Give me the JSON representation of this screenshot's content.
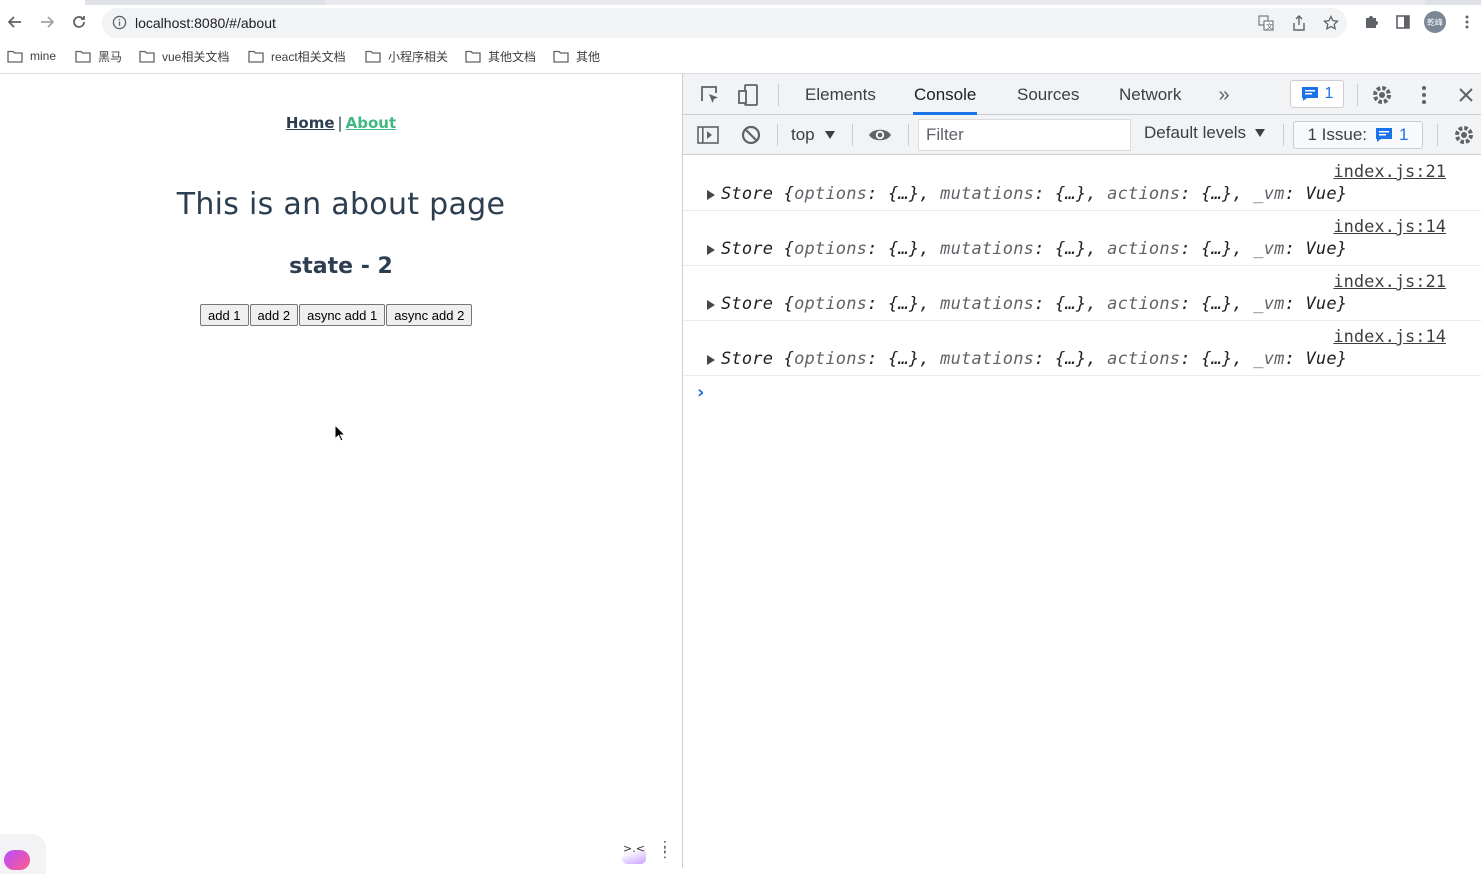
{
  "browser": {
    "url": "localhost:8080/#/about",
    "profile_label": "乾峰",
    "bookmarks": [
      "mine",
      "黑马",
      "vue相关文档",
      "react相关文档",
      "小程序相关",
      "其他文档",
      "其他"
    ]
  },
  "page": {
    "nav": {
      "home": "Home",
      "separator": "|",
      "about": "About"
    },
    "title": "This is an about page",
    "state_text": "state - 2",
    "buttons": [
      "add 1",
      "add 2",
      "async add 1",
      "async add 2"
    ],
    "bottom_right_icon_text": ">.<",
    "colors": {
      "text": "#2c3e50",
      "active_link": "#42b983"
    }
  },
  "devtools": {
    "tabs": [
      "Elements",
      "Console",
      "Sources",
      "Network"
    ],
    "active_tab": "Console",
    "message_count": "1",
    "context": "top",
    "filter_placeholder": "Filter",
    "levels": "Default levels",
    "issues_label": "1 Issue:",
    "issues_count": "1",
    "accent": "#1a73e8"
  },
  "console": {
    "logs": [
      {
        "source": "index.js:21",
        "class": "Store",
        "parts": [
          {
            "k": "options",
            "v": "{…}"
          },
          {
            "k": "mutations",
            "v": "{…}"
          },
          {
            "k": "actions",
            "v": "{…}"
          },
          {
            "k": "_vm",
            "v": "Vue"
          }
        ]
      },
      {
        "source": "index.js:14",
        "class": "Store",
        "parts": [
          {
            "k": "options",
            "v": "{…}"
          },
          {
            "k": "mutations",
            "v": "{…}"
          },
          {
            "k": "actions",
            "v": "{…}"
          },
          {
            "k": "_vm",
            "v": "Vue"
          }
        ]
      },
      {
        "source": "index.js:21",
        "class": "Store",
        "parts": [
          {
            "k": "options",
            "v": "{…}"
          },
          {
            "k": "mutations",
            "v": "{…}"
          },
          {
            "k": "actions",
            "v": "{…}"
          },
          {
            "k": "_vm",
            "v": "Vue"
          }
        ]
      },
      {
        "source": "index.js:14",
        "class": "Store",
        "parts": [
          {
            "k": "options",
            "v": "{…}"
          },
          {
            "k": "mutations",
            "v": "{…}"
          },
          {
            "k": "actions",
            "v": "{…}"
          },
          {
            "k": "_vm",
            "v": "Vue"
          }
        ]
      }
    ],
    "prompt": "›"
  }
}
